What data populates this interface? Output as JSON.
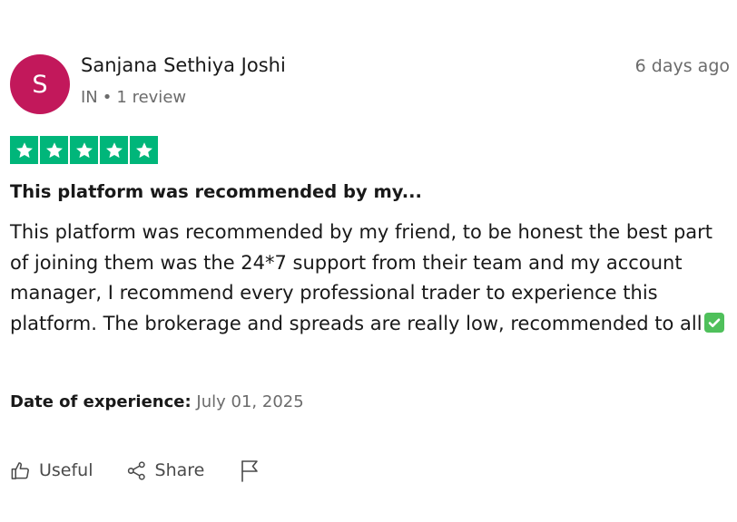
{
  "reviewer": {
    "avatar_initial": "S",
    "avatar_color": "#c2185b",
    "name": "Sanjana Sethiya Joshi",
    "country": "IN",
    "separator": "•",
    "review_count": "1 review"
  },
  "posted": "6 days ago",
  "rating": {
    "stars": 5,
    "max": 5,
    "color": "#00b67a"
  },
  "review": {
    "title": "This platform was recommended by my...",
    "body": "This platform was recommended by my friend, to be honest the best part of joining them was the 24*7 support from their team and my account manager, I recommend every professional trader to experience this platform. The brokerage and spreads are really low, recommended to all",
    "trailing_icon": "check-mark-emoji"
  },
  "experience": {
    "label": "Date of experience:",
    "date": "July 01, 2025"
  },
  "actions": {
    "useful_label": "Useful",
    "useful_icon": "thumbs-up-icon",
    "share_label": "Share",
    "share_icon": "share-icon",
    "report_icon": "flag-icon"
  }
}
